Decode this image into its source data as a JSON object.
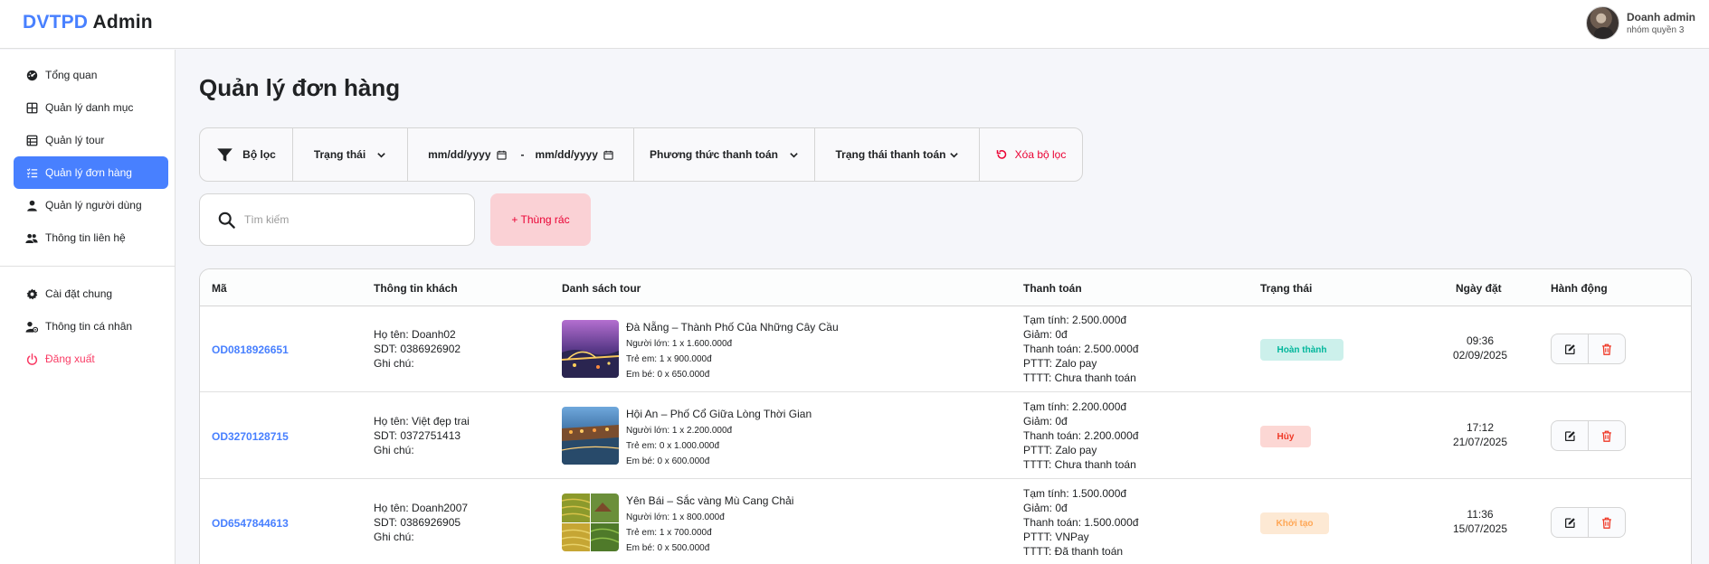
{
  "app": {
    "brand_accent": "DVTPD",
    "brand_rest": "Admin"
  },
  "user": {
    "name": "Doanh admin",
    "role": "nhóm quyền 3"
  },
  "sidebar": {
    "items": [
      {
        "label": "Tổng quan",
        "icon": "dashboard-icon"
      },
      {
        "label": "Quản lý danh mục",
        "icon": "grid-icon"
      },
      {
        "label": "Quản lý tour",
        "icon": "table-icon"
      },
      {
        "label": "Quản lý đơn hàng",
        "icon": "list-check-icon",
        "active": true
      },
      {
        "label": "Quản lý người dùng",
        "icon": "user-icon"
      },
      {
        "label": "Thông tin liên hệ",
        "icon": "users-icon"
      }
    ],
    "bottom_items": [
      {
        "label": "Cài đặt chung",
        "icon": "gear-icon"
      },
      {
        "label": "Thông tin cá nhân",
        "icon": "user-gear-icon"
      },
      {
        "label": "Đăng xuất",
        "icon": "power-icon"
      }
    ]
  },
  "page": {
    "title": "Quản lý đơn hàng"
  },
  "filters": {
    "filter_label": "Bộ lọc",
    "status": "Trạng thái",
    "date_from": "mm/dd/yyyy",
    "date_sep": "-",
    "date_to": "mm/dd/yyyy",
    "payment_method": "Phương thức thanh toán",
    "payment_status": "Trạng thái thanh toán",
    "clear": "Xóa bộ lọc"
  },
  "search": {
    "placeholder": "Tìm kiếm"
  },
  "trash_button": "+ Thùng rác",
  "table": {
    "headers": [
      "Mã",
      "Thông tin khách",
      "Danh sách tour",
      "Thanh toán",
      "Trạng thái",
      "Ngày đặt",
      "Hành động"
    ],
    "rows": [
      {
        "code": "OD0818926651",
        "name": "Họ tên: Doanh02",
        "phone": "SDT: 0386926902",
        "note": "Ghi chú:",
        "tour_name": "Đà Nẵng – Thành Phố Của Những Cây Cầu",
        "adult": "Người lớn: 1 x 1.600.000đ",
        "child": "Trẻ em: 1 x 900.000đ",
        "baby": "Em bé: 0 x 650.000đ",
        "subtotal": "Tạm tính: 2.500.000đ",
        "discount": "Giảm: 0đ",
        "total": "Thanh toán: 2.500.000đ",
        "method": "PTTT: Zalo pay",
        "pay_status": "TTTT: Chưa thanh toán",
        "status": "Hoàn thành",
        "time": "09:36",
        "date": "02/09/2025"
      },
      {
        "code": "OD3270128715",
        "name": "Họ tên: Việt đẹp trai",
        "phone": "SDT: 0372751413",
        "note": "Ghi chú:",
        "tour_name": "Hội An – Phố Cổ Giữa Lòng Thời Gian",
        "adult": "Người lớn: 1 x 2.200.000đ",
        "child": "Trẻ em: 0 x 1.000.000đ",
        "baby": "Em bé: 0 x 600.000đ",
        "subtotal": "Tạm tính: 2.200.000đ",
        "discount": "Giảm: 0đ",
        "total": "Thanh toán: 2.200.000đ",
        "method": "PTTT: Zalo pay",
        "pay_status": "TTTT: Chưa thanh toán",
        "status": "Hủy",
        "time": "17:12",
        "date": "21/07/2025"
      },
      {
        "code": "OD6547844613",
        "name": "Họ tên: Doanh2007",
        "phone": "SDT: 0386926905",
        "note": "Ghi chú:",
        "tour_name": "Yên Bái – Sắc vàng Mù Cang Chải",
        "adult": "Người lớn: 1 x 800.000đ",
        "child": "Trẻ em: 1 x 700.000đ",
        "baby": "Em bé: 0 x 500.000đ",
        "subtotal": "Tạm tính: 1.500.000đ",
        "discount": "Giảm: 0đ",
        "total": "Thanh toán: 1.500.000đ",
        "method": "PTTT: VNPay",
        "pay_status": "TTTT: Đã thanh toán",
        "status": "Khởi tạo",
        "time": "11:36",
        "date": "15/07/2025"
      }
    ]
  },
  "colors": {
    "accent": "#4880ff",
    "danger": "#ea0234",
    "done": "#00b69b",
    "cancel": "#ef3826",
    "init": "#ffa756"
  }
}
